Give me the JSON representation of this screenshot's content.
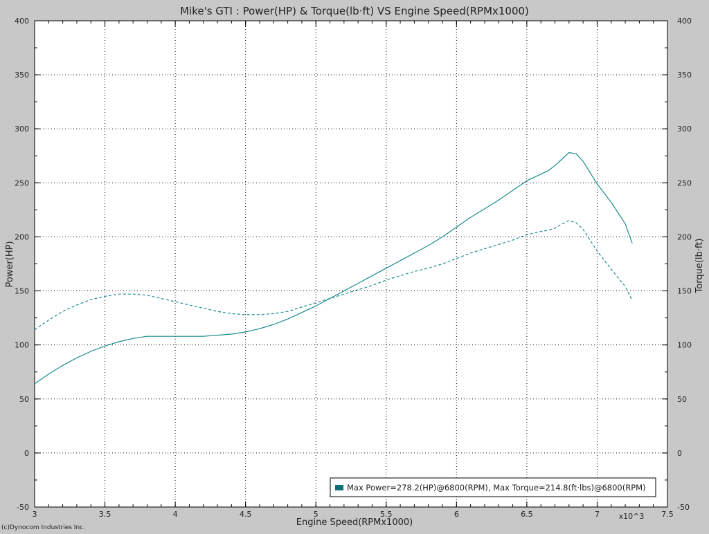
{
  "chart_data": {
    "type": "line",
    "title": "Mike's GTI : Power(HP) & Torque(lb·ft) VS Engine Speed(RPMx1000)",
    "xlabel": "Engine Speed(RPMx1000)",
    "ylabel": "Power(HP)",
    "y2label": "Torque(lb·ft)",
    "x_multiplier_label": "x10^3",
    "credit": "(c)Dynocom Industries Inc.",
    "xlim": [
      3,
      7.5
    ],
    "ylim": [
      -50,
      400
    ],
    "xticks": [
      "3",
      "3.5",
      "4",
      "4.5",
      "5",
      "5.5",
      "6",
      "6.5",
      "7",
      "7.5"
    ],
    "yticks": [
      "-50",
      "0",
      "50",
      "100",
      "150",
      "200",
      "250",
      "300",
      "350",
      "400"
    ],
    "grid": true,
    "legend_position": "bottom-right",
    "legend_text": "Max Power=278.2(HP)@6800(RPM), Max Torque=214.8(ft·lbs)@6800(RPM)",
    "series_color": "#1a8a8e",
    "legend_swatch_color": "#0f6f78",
    "series": [
      {
        "name": "Power",
        "style": "solid",
        "x": [
          3.0,
          3.1,
          3.2,
          3.3,
          3.4,
          3.5,
          3.6,
          3.7,
          3.8,
          3.9,
          4.0,
          4.1,
          4.2,
          4.3,
          4.4,
          4.5,
          4.6,
          4.7,
          4.8,
          4.9,
          5.0,
          5.1,
          5.2,
          5.3,
          5.4,
          5.5,
          5.6,
          5.7,
          5.8,
          5.9,
          6.0,
          6.1,
          6.2,
          6.3,
          6.4,
          6.5,
          6.6,
          6.65,
          6.7,
          6.75,
          6.8,
          6.85,
          6.9,
          7.0,
          7.1,
          7.2,
          7.25
        ],
        "values": [
          64,
          73,
          81,
          88,
          94,
          99,
          103,
          106,
          108,
          108,
          108,
          108,
          108,
          109,
          110,
          112,
          115,
          119,
          124,
          130,
          136,
          143,
          150,
          157,
          164,
          171,
          178,
          185,
          192,
          200,
          209,
          218,
          226,
          234,
          243,
          252,
          258,
          261,
          266,
          272,
          278,
          277,
          270,
          249,
          232,
          212,
          194
        ]
      },
      {
        "name": "Torque",
        "style": "dashed",
        "x": [
          3.0,
          3.1,
          3.2,
          3.3,
          3.4,
          3.5,
          3.6,
          3.7,
          3.8,
          3.9,
          4.0,
          4.1,
          4.2,
          4.3,
          4.4,
          4.5,
          4.6,
          4.7,
          4.8,
          4.9,
          5.0,
          5.1,
          5.2,
          5.3,
          5.4,
          5.5,
          5.6,
          5.7,
          5.8,
          5.9,
          6.0,
          6.1,
          6.2,
          6.3,
          6.4,
          6.5,
          6.6,
          6.65,
          6.7,
          6.75,
          6.8,
          6.85,
          6.9,
          7.0,
          7.1,
          7.2,
          7.25
        ],
        "values": [
          114,
          123,
          131,
          137,
          142,
          145,
          147,
          147,
          146,
          143,
          140,
          137,
          134,
          131,
          129,
          128,
          128,
          129,
          131,
          135,
          139,
          143,
          147,
          151,
          155,
          160,
          164,
          168,
          171,
          175,
          180,
          185,
          189,
          193,
          197,
          202,
          205,
          206,
          208,
          212,
          215,
          213,
          207,
          187,
          170,
          154,
          141
        ]
      }
    ]
  }
}
